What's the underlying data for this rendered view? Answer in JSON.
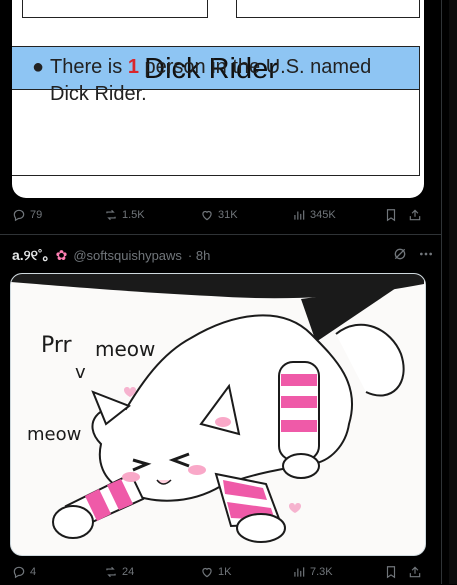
{
  "post1": {
    "card": {
      "title": "Dick Rider",
      "text_before": "There is",
      "number": "1",
      "text_after": "person in the U.S. named Dick Rider."
    },
    "actions": {
      "replies": "79",
      "reposts": "1.5K",
      "likes": "31K",
      "views": "345K"
    }
  },
  "post2": {
    "display_name": "a.୨୧˚｡",
    "handle": "@softsquishypaws",
    "time": "· 8h",
    "image": {
      "text_prr": "Prr",
      "text_meow1": "meow",
      "text_v": "v",
      "text_meow2": "meow"
    },
    "actions": {
      "replies": "4",
      "reposts": "24",
      "likes": "1K",
      "views": "7.3K"
    }
  },
  "colors": {
    "background": "#000000",
    "muted": "#71767b",
    "title_band": "#8ec5f3",
    "highlight": "#d9262c",
    "cat_stripe": "#ef5aa8"
  }
}
